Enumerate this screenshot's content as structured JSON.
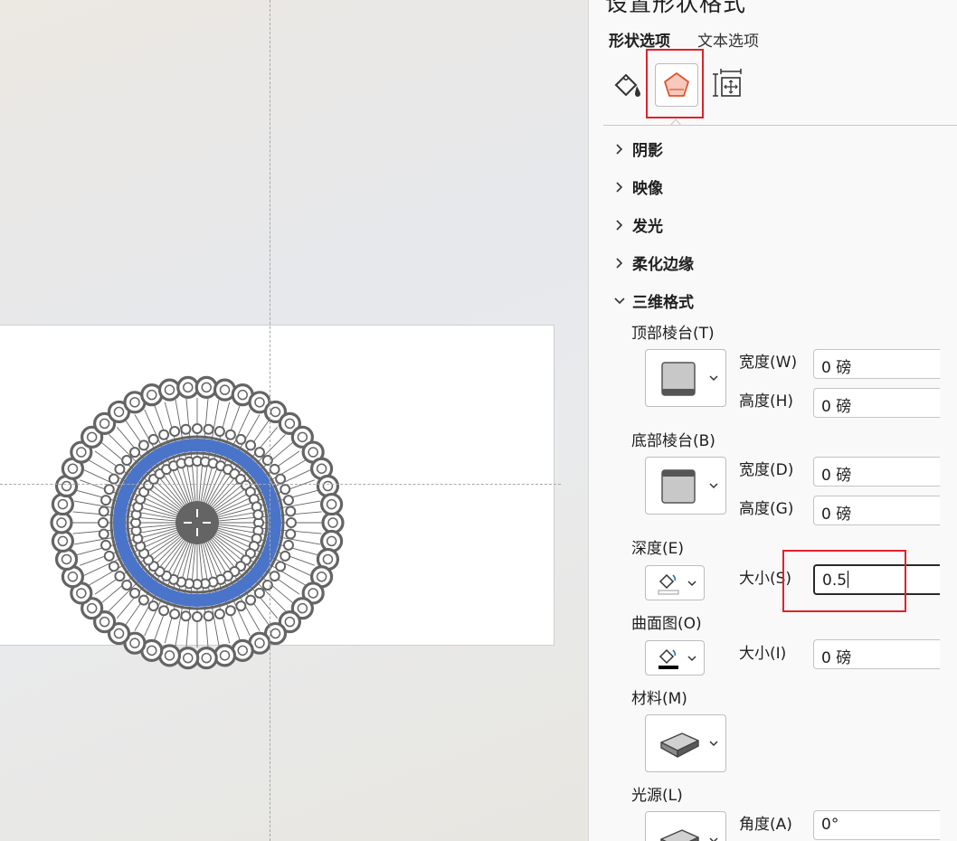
{
  "pane": {
    "title": "设置形状格式",
    "tabs": {
      "shape_options": "形状选项",
      "text_options": "文本选项"
    },
    "icons": {
      "fill": "paint-bucket-icon",
      "effects": "pentagon-icon",
      "size": "size-properties-icon"
    },
    "sections": {
      "shadow": "阴影",
      "reflection": "映像",
      "glow": "发光",
      "soft_edges": "柔化边缘",
      "format_3d": "三维格式"
    },
    "format_3d": {
      "top_bevel": {
        "label": "顶部棱台(T)",
        "width_label": "宽度(W)",
        "width_value": "0 磅",
        "height_label": "高度(H)",
        "height_value": "0 磅"
      },
      "bottom_bevel": {
        "label": "底部棱台(B)",
        "width_label": "宽度(D)",
        "width_value": "0 磅",
        "height_label": "高度(G)",
        "height_value": "0 磅"
      },
      "depth": {
        "label": "深度(E)",
        "size_label": "大小(S)",
        "size_value": "0.5"
      },
      "contour": {
        "label": "曲面图(O)",
        "size_label": "大小(I)",
        "size_value": "0 磅"
      },
      "material": {
        "label": "材料(M)"
      },
      "lighting": {
        "label": "光源(L)",
        "angle_label": "角度(A)",
        "angle_value": "0°"
      }
    }
  },
  "colors": {
    "accent_red": "#e0212a",
    "mandala_gray": "#646464",
    "mandala_blue": "#4a74c9"
  }
}
